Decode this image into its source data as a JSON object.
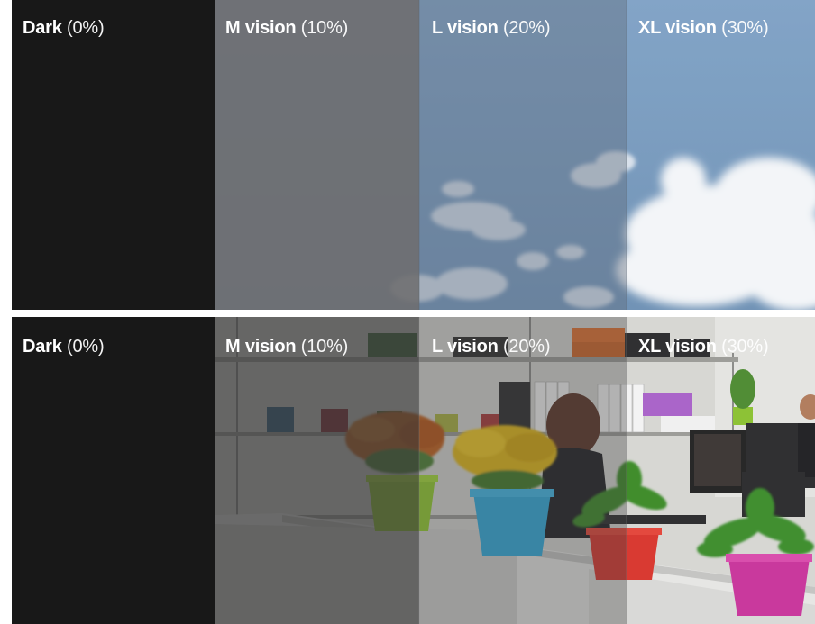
{
  "comparison": {
    "top": {
      "columns": [
        {
          "name": "Dark",
          "pct": "(0%)"
        },
        {
          "name": "M vision",
          "pct": "(10%)"
        },
        {
          "name": "L vision",
          "pct": "(20%)"
        },
        {
          "name": "XL vision",
          "pct": "(30%)"
        }
      ]
    },
    "bottom": {
      "columns": [
        {
          "name": "Dark",
          "pct": "(0%)"
        },
        {
          "name": "M vision",
          "pct": "(10%)"
        },
        {
          "name": "L vision",
          "pct": "(20%)"
        },
        {
          "name": "XL vision",
          "pct": "(30%)"
        }
      ]
    }
  },
  "colors": {
    "dark": "#181818",
    "sky": "#6f92b8",
    "cloud": "#f4f6f8",
    "office_wall": "#d9d9d6",
    "pot_green": "#8fce2e",
    "pot_blue": "#2fa9d9",
    "pot_red": "#d8342c",
    "pot_pink": "#c8339a"
  },
  "icons": [
    "sky-photo",
    "office-photo"
  ]
}
